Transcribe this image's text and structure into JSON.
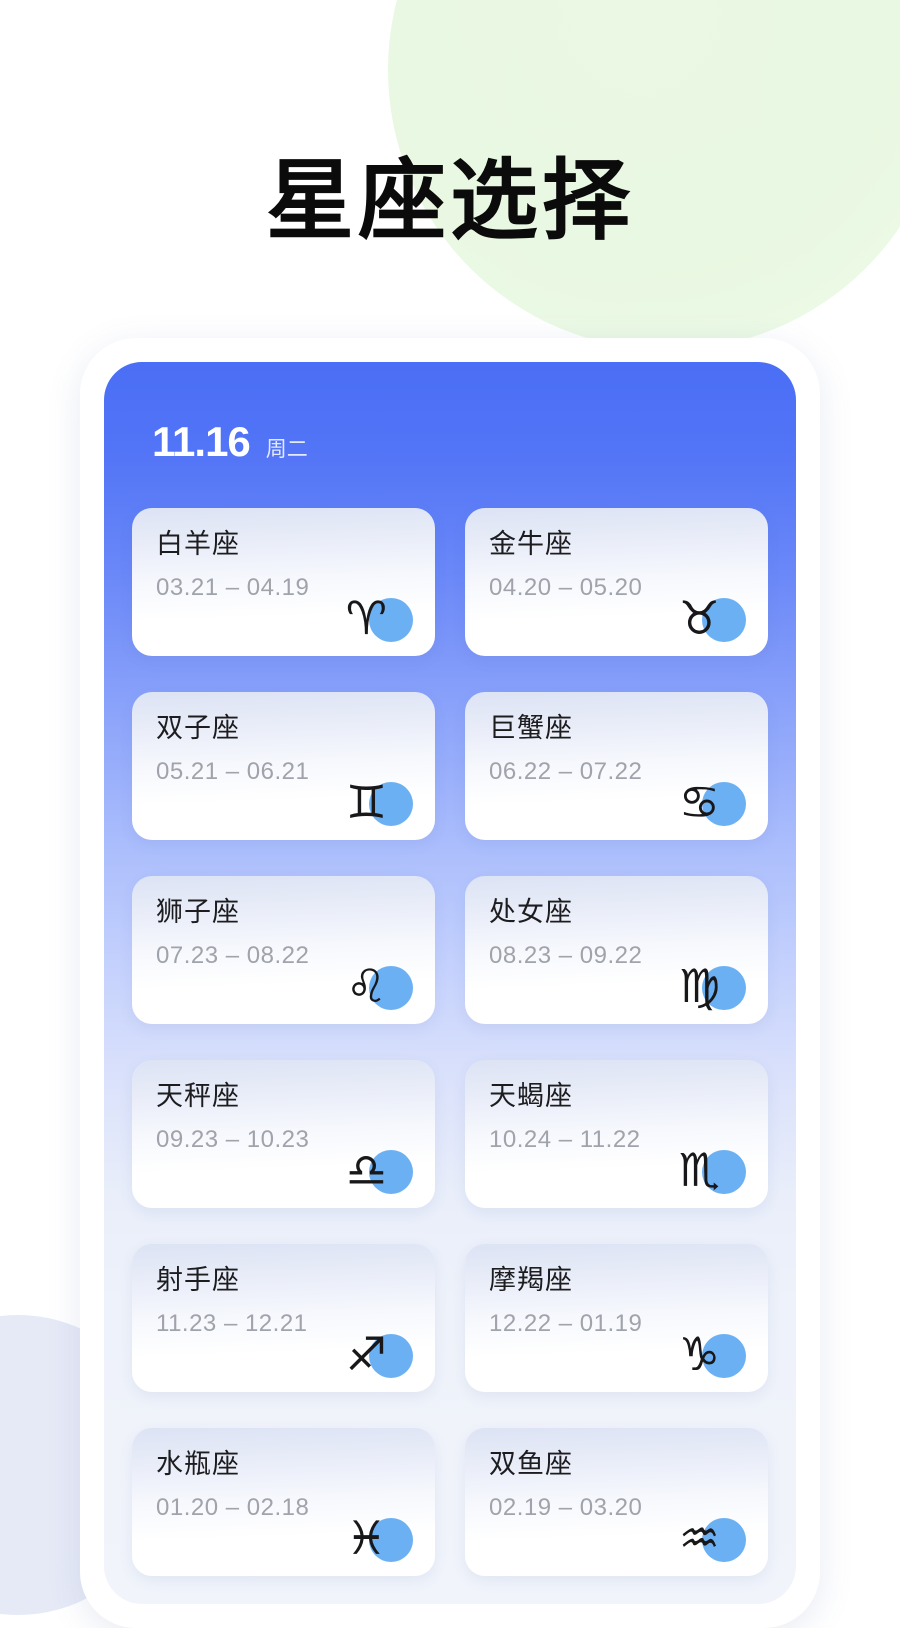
{
  "page": {
    "title": "星座选择",
    "background_color": "#ffffff",
    "accent_blue": "#4a6ef5",
    "dot_blue": "#6cb0f4",
    "blob_green": "#e9f8e2",
    "blob_lavender": "#e6eaf7"
  },
  "phone": {
    "header": {
      "date": "11.16",
      "weekday": "周二"
    },
    "cards": [
      {
        "name": "白羊座",
        "range": "03.21 – 04.19",
        "symbol": "♈",
        "symbol_name": "aries-symbol"
      },
      {
        "name": "金牛座",
        "range": "04.20 – 05.20",
        "symbol": "♉",
        "symbol_name": "taurus-symbol"
      },
      {
        "name": "双子座",
        "range": "05.21 – 06.21",
        "symbol": "♊",
        "symbol_name": "gemini-symbol"
      },
      {
        "name": "巨蟹座",
        "range": "06.22 – 07.22",
        "symbol": "♋",
        "symbol_name": "cancer-symbol"
      },
      {
        "name": "狮子座",
        "range": "07.23 – 08.22",
        "symbol": "♌",
        "symbol_name": "leo-symbol"
      },
      {
        "name": "处女座",
        "range": "08.23 – 09.22",
        "symbol": "♍",
        "symbol_name": "virgo-symbol"
      },
      {
        "name": "天秤座",
        "range": "09.23 – 10.23",
        "symbol": "♎",
        "symbol_name": "libra-symbol"
      },
      {
        "name": "天蝎座",
        "range": "10.24 – 11.22",
        "symbol": "♏",
        "symbol_name": "scorpio-symbol"
      },
      {
        "name": "射手座",
        "range": "11.23 – 12.21",
        "symbol": "♐",
        "symbol_name": "sagittarius-symbol"
      },
      {
        "name": "摩羯座",
        "range": "12.22 – 01.19",
        "symbol": "♑",
        "symbol_name": "capricorn-symbol"
      },
      {
        "name": "水瓶座",
        "range": "01.20 – 02.18",
        "symbol": "♓",
        "symbol_name": "pisces-symbol"
      },
      {
        "name": "双鱼座",
        "range": "02.19 – 03.20",
        "symbol": "♒",
        "symbol_name": "aquarius-symbol"
      }
    ]
  }
}
